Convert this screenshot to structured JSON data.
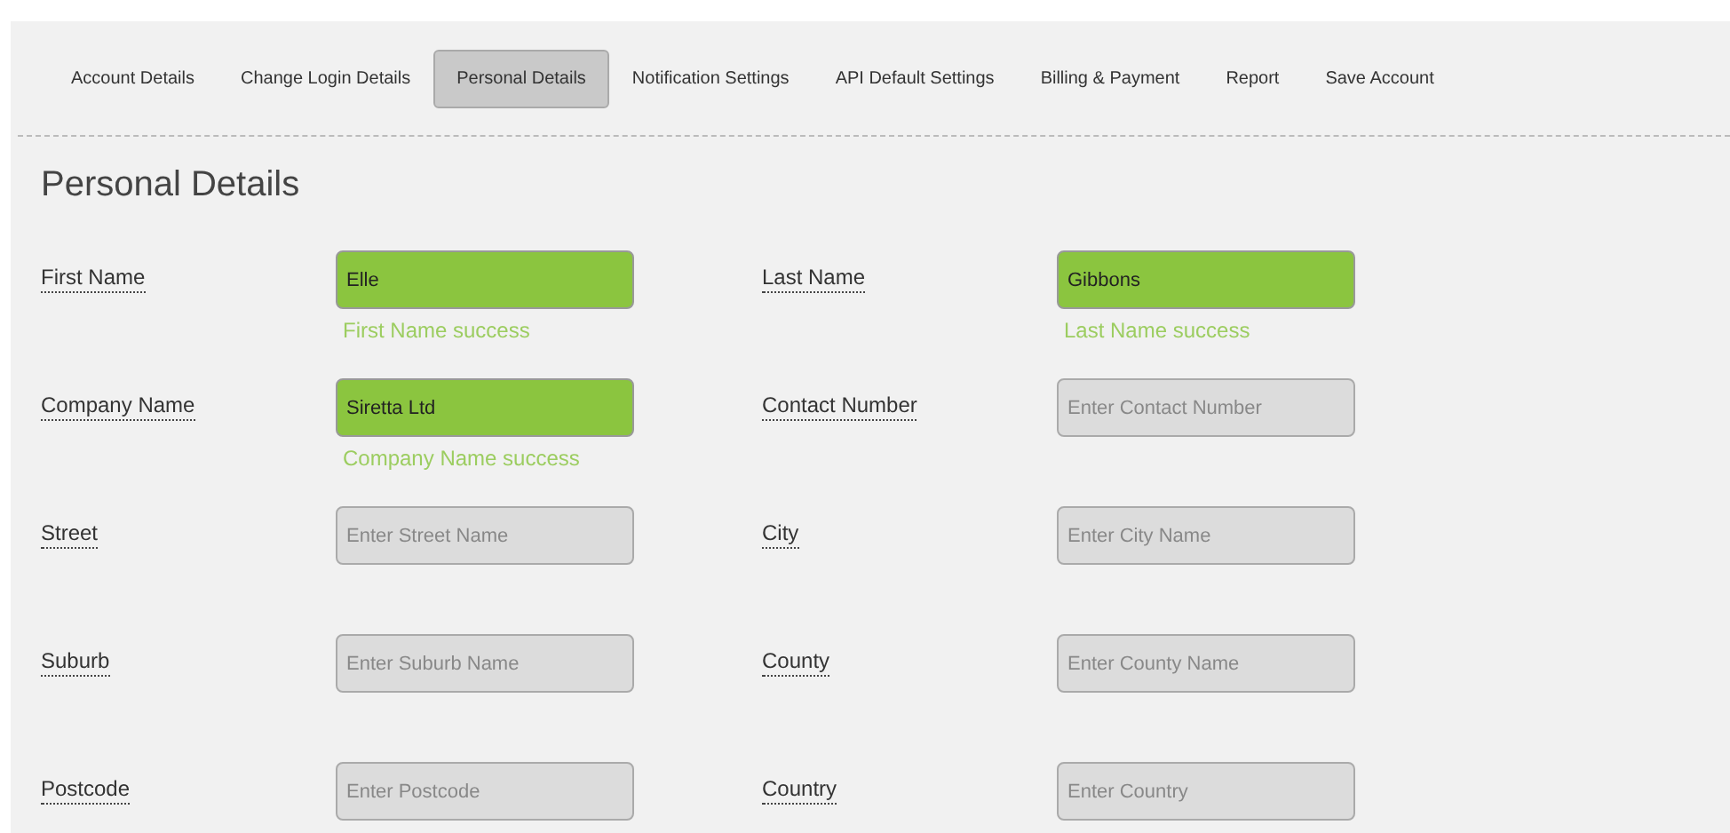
{
  "tabs": [
    {
      "label": "Account Details",
      "selected": false
    },
    {
      "label": "Change Login Details",
      "selected": false
    },
    {
      "label": "Personal Details",
      "selected": true
    },
    {
      "label": "Notification Settings",
      "selected": false
    },
    {
      "label": "API Default Settings",
      "selected": false
    },
    {
      "label": "Billing & Payment",
      "selected": false
    },
    {
      "label": "Report",
      "selected": false
    },
    {
      "label": "Save Account",
      "selected": false
    }
  ],
  "heading": "Personal Details",
  "rows": [
    [
      {
        "label": "First Name",
        "value": "Elle",
        "valid": true,
        "message": "First Name success"
      },
      {
        "label": "Last Name",
        "value": "Gibbons",
        "valid": true,
        "message": "Last Name success"
      }
    ],
    [
      {
        "label": "Company Name",
        "value": "Siretta Ltd",
        "valid": true,
        "message": "Company Name success"
      },
      {
        "label": "Contact Number",
        "placeholder": "Enter Contact Number",
        "valid": false
      }
    ],
    [
      {
        "label": "Street",
        "placeholder": "Enter Street Name",
        "valid": false
      },
      {
        "label": "City",
        "placeholder": "Enter City Name",
        "valid": false
      }
    ],
    [
      {
        "label": "Suburb",
        "placeholder": "Enter Suburb Name",
        "valid": false
      },
      {
        "label": "County",
        "placeholder": "Enter County Name",
        "valid": false
      }
    ],
    [
      {
        "label": "Postcode",
        "placeholder": "Enter Postcode",
        "valid": false
      },
      {
        "label": "Country",
        "placeholder": "Enter Country",
        "valid": false
      }
    ]
  ]
}
